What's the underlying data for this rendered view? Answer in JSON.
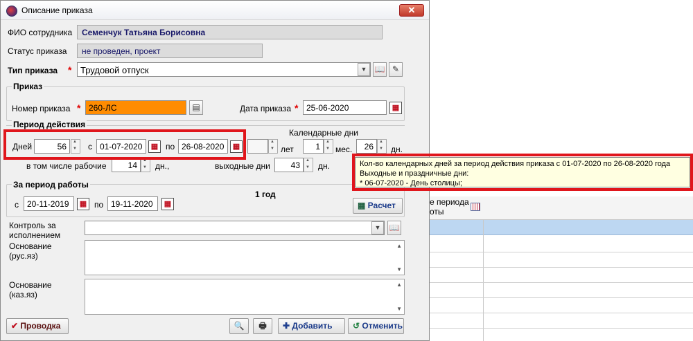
{
  "window": {
    "title": "Описание приказа",
    "close_label": "✕"
  },
  "employee": {
    "label": "ФИО сотрудника",
    "value": "Семенчук Татьяна Борисовна"
  },
  "status": {
    "label": "Статус приказа",
    "value": "не проведен, проект"
  },
  "order_type": {
    "label": "Тип приказа",
    "value": "Трудовой отпуск"
  },
  "order_group": {
    "title": "Приказ",
    "number_label": "Номер приказа",
    "number_value": "260-ЛС",
    "date_label": "Дата приказа",
    "date_value": "25-06-2020"
  },
  "period_group": {
    "title": "Период действия",
    "days_label": "Дней",
    "days_value": "56",
    "from_label": "с",
    "from_value": "01-07-2020",
    "to_label": "по",
    "to_value": "26-08-2020",
    "calendar_days_label": "Календарные дни",
    "years_label": "лет",
    "months_value": "1",
    "months_label": "мес.",
    "cal_days_value": "26",
    "cal_days_label": "дн.",
    "workdays_label": "в том числе рабочие",
    "workdays_value": "14",
    "workdays_unit": "дн.,",
    "weekend_label": "выходные дни",
    "weekend_value": "43",
    "weekend_unit": "дн."
  },
  "work_period_group": {
    "title": "За период работы",
    "duration": "1 год",
    "from_label": "с",
    "from_value": "20-11-2019",
    "to_label": "по",
    "to_value": "19-11-2020",
    "calc_label": "Расчет"
  },
  "control": {
    "label": "Контроль за\nисполнением",
    "value": ""
  },
  "basis_ru": {
    "label": "Основание\n(рус.яз)"
  },
  "basis_kz": {
    "label": "Основание\n(каз.яз)"
  },
  "footer": {
    "post_label": "Проводка",
    "add_label": "Добавить",
    "cancel_label": "Отменить"
  },
  "tooltip": {
    "line1": "Кол-во календарных дней за период действия приказа с 01-07-2020 по 26-08-2020 года",
    "line2": "Выходные и праздничные дни:",
    "line3": "* 06-07-2020 - День столицы;"
  },
  "background_grid": {
    "header": "е периода\nоты"
  },
  "colors": {
    "required": "#e00000",
    "highlight": "#e0161c",
    "order_number_bg": "#ff8c00",
    "tooltip_bg": "#ffffe1"
  }
}
